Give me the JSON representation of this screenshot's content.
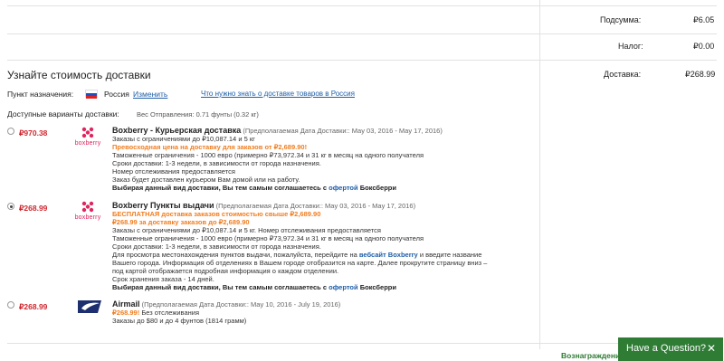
{
  "summary": {
    "subtotal_label": "Подсумма:",
    "subtotal_value": "₽6.05",
    "tax_label": "Налог:",
    "tax_value": "₽0.00",
    "shipping_label": "Доставка:",
    "shipping_value": "₽268.99"
  },
  "shipping": {
    "title": "Узнайте стоимость доставки",
    "destination_label": "Пункт назначения:",
    "country": "Россия",
    "change_link": "Изменить",
    "info_link": "Что нужно знать о доставке товаров в Россия",
    "available_label": "Доступные варианты доставки:",
    "weight": "Вес Отправления: 0.71 фунты (0.32 кг)"
  },
  "options": [
    {
      "price": "₽970.38",
      "logo": "boxberry",
      "name": "Boxberry - Курьерская доставка",
      "dates": "(Предполагаемая Дата Доставки:: May 03, 2016 - May 17, 2016)",
      "line1": "Заказы с ограничениями до ₽10,087.14 и 5 кг",
      "promo": "Превосходная цена на доставку для заказов от ₽2,689.90!",
      "line3": "Таможенные ограничения - 1000 евро (примерно ₽73,972.34 и 31 кг в месяц на одного получателя",
      "line4": "Сроки доставки: 1-3 недели, в зависимости от города назначения.",
      "line5": "Номер отслеживания предоставляется",
      "line6": "Заказ будет доставлен курьером Вам домой или на работу.",
      "agree_prefix": "Выбирая данный вид доставки, Вы тем самым соглашаетесь с",
      "agree_link": "офертой",
      "agree_suffix": "Боксберри"
    },
    {
      "price": "₽268.99",
      "logo": "boxberry",
      "name": "Boxberry Пункты выдачи",
      "dates": "(Предполагаемая Дата Доставки:: May 03, 2016 - May 17, 2016)",
      "promo1": "БЕСПЛАТНАЯ доставка заказов стоимостью свыше ₽2,689.90",
      "promo2": "₽268.99 за доставку заказов до ₽2,689.90",
      "line3": "Заказы с ограничениями до ₽10,087.14 и 5 кг. Номер отслеживания предоставляется",
      "line4": "Таможенные ограничения - 1000 евро (примерно ₽73,972.34 и 31 кг в месяц на одного получателя",
      "line5": "Сроки доставки: 1-3 недели, в зависимости от города назначения.",
      "line6_prefix": "Для просмотра местонахождения пунктов выдачи, пожалуйста, перейдите на",
      "line6_link": "вебсайт Boxberry",
      "line6_suffix": "и введите название",
      "line7": "Вашего города. Информация об отделениях в Вашем городе отобразится на карте. Далее прокрутите страницу вниз –",
      "line8": "под картой отображается подробная информация о каждом отделении.",
      "line9": "Срок хранения заказа - 14 дней.",
      "agree_prefix": "Выбирая данный вид доставки, Вы тем самым соглашаетесь с",
      "agree_link": "офертой",
      "agree_suffix": "Боксберри"
    },
    {
      "price": "₽268.99",
      "logo": "usps",
      "name": "Airmail",
      "dates": "(Предполагаемая Дата Доставки:: May 10, 2016 - July 19, 2016)",
      "price_tag": "₽268.99!",
      "tracking": "Без отслеживания",
      "line3": "Заказы до $80 и до 4 фунтов (1814 грамм)"
    }
  ],
  "chat": {
    "label": "Have a Question?",
    "close": "✕"
  },
  "partial_text": "Вознаграждения"
}
